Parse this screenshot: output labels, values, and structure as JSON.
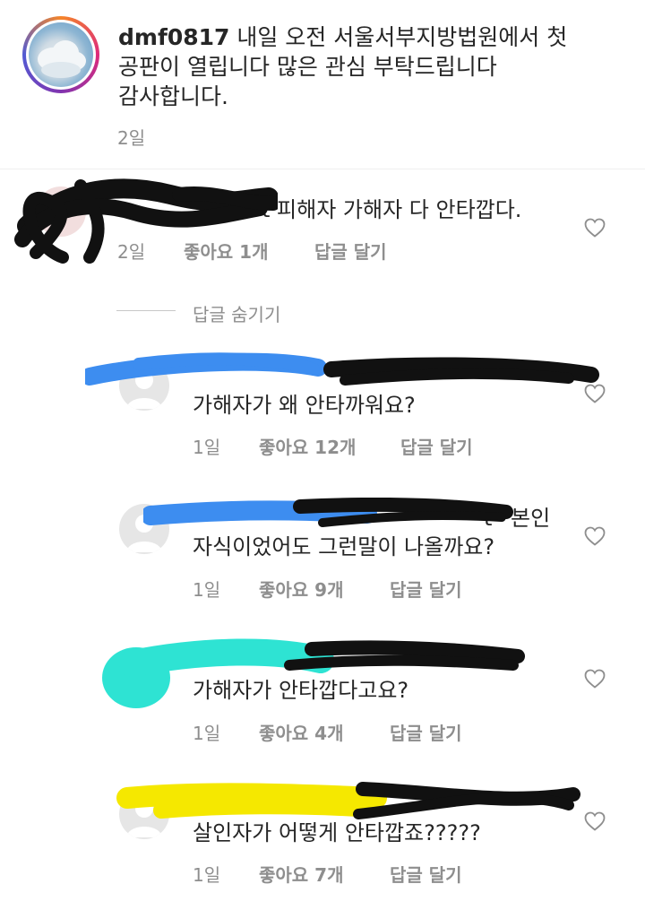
{
  "post": {
    "username": "dmf0817",
    "caption_line1": "내일 오전 서울서부지방법원에서 첫",
    "caption_line2": "공판이 열립니다 많은 관심 부탁드립니다",
    "caption_line3": "감사합니다.",
    "time": "2일"
  },
  "comment": {
    "text_fragment": "t 피해자 가해자 다 안타깝다.",
    "time": "2일",
    "likes": "좋아요 1개",
    "reply": "답글 달기",
    "hide_replies": "답글 숨기기"
  },
  "replies": [
    {
      "mention_fragment": "",
      "line1": "",
      "line2": "가해자가 왜 안타까워요?",
      "time": "1일",
      "likes": "좋아요 12개",
      "reply": "답글 달기"
    },
    {
      "mention_fragment": "t",
      "line1": "본인",
      "line2": "자식이었어도 그런말이 나올까요?",
      "time": "1일",
      "likes": "좋아요 9개",
      "reply": "답글 달기"
    },
    {
      "mention_fragment": "",
      "line1": "",
      "line2": "가해자가 안타깝다고요?",
      "time": "1일",
      "likes": "좋아요 4개",
      "reply": "답글 달기"
    },
    {
      "mention_fragment": "",
      "line1": "",
      "line2": "살인자가 어떻게 안타깝죠?????",
      "time": "1일",
      "likes": "좋아요 7개",
      "reply": "답글 달기"
    }
  ],
  "colors": {
    "text": "#262626",
    "meta": "#8e8e8e",
    "scribble_black": "#111111",
    "scribble_blue": "#3d8df0",
    "scribble_cyan": "#2ee3d3",
    "scribble_yellow": "#f5e800"
  },
  "icons": {
    "like": "heart-outline-icon",
    "avatar_placeholder": "default-user-icon"
  }
}
